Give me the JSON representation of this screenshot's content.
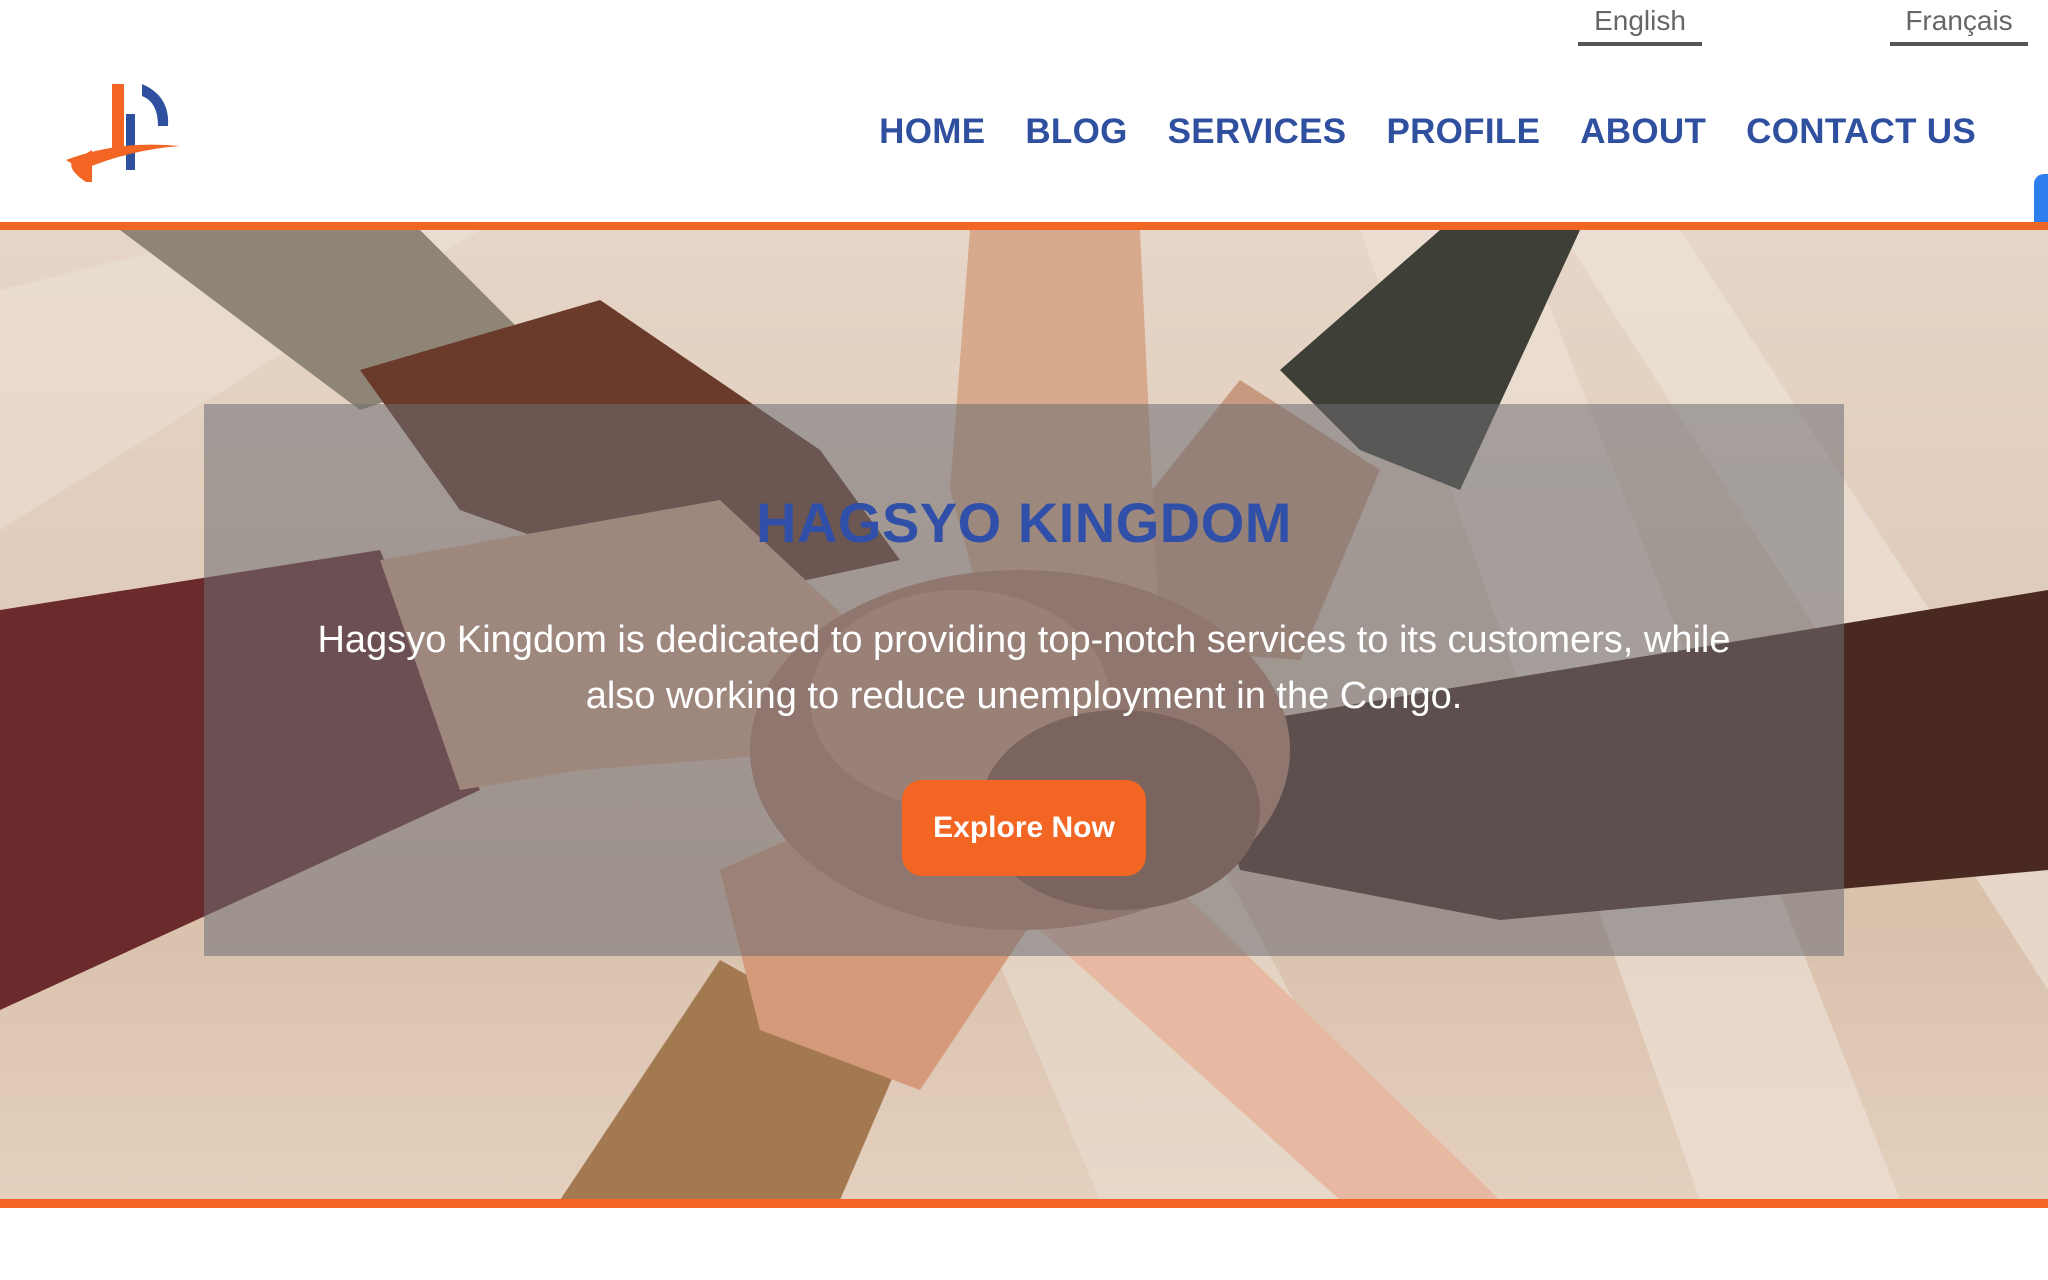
{
  "language_switch": {
    "english": "English",
    "french": "Français"
  },
  "nav": {
    "items": [
      {
        "label": "HOME"
      },
      {
        "label": "BLOG"
      },
      {
        "label": "SERVICES"
      },
      {
        "label": "PROFILE"
      },
      {
        "label": "ABOUT"
      },
      {
        "label": "CONTACT US"
      }
    ]
  },
  "hero": {
    "title": "HAGSYO KINGDOM",
    "description": "Hagsyo Kingdom is dedicated to providing top-notch services to its customers, while also working to reduce unemployment in the Congo.",
    "cta_label": "Explore Now"
  },
  "colors": {
    "brand_blue": "#2f4f9f",
    "accent_orange": "#f26522",
    "scroll_tab_blue": "#2d7ff0"
  },
  "icons": {
    "logo": "hagsyo-logo",
    "side_tab": "side-scroll-tab"
  }
}
